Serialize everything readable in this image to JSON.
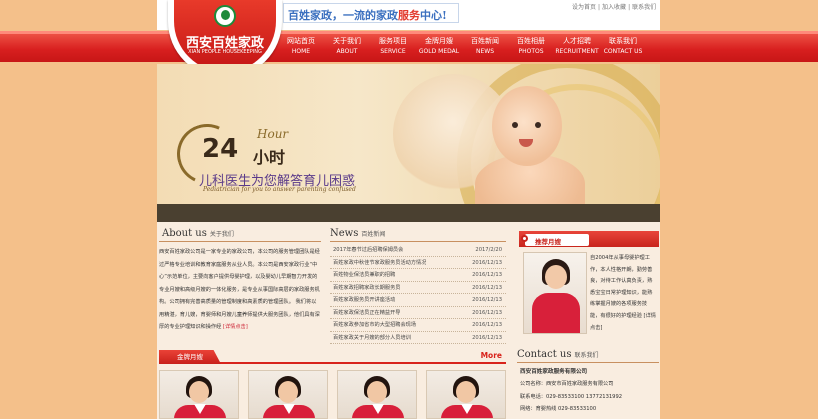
{
  "slogan": {
    "blue": "百姓家政，一流的家政",
    "red": "服务",
    "end": "中心!"
  },
  "toplinks": [
    "设为首页",
    "|",
    "加入收藏",
    "|",
    "联系我们"
  ],
  "logo": {
    "zh": "西安百姓家政",
    "en": "XIAN PEOPLE HOUSEKEEPING"
  },
  "nav": [
    {
      "zh": "网站首页",
      "en": "HOME"
    },
    {
      "zh": "关于我们",
      "en": "ABOUT"
    },
    {
      "zh": "服务项目",
      "en": "SERVICE"
    },
    {
      "zh": "金牌月嫂",
      "en": "GOLD MEDAL"
    },
    {
      "zh": "百姓新闻",
      "en": "NEWS"
    },
    {
      "zh": "百姓相册",
      "en": "PHOTOS"
    },
    {
      "zh": "人才招聘",
      "en": "RECRUITMENT"
    },
    {
      "zh": "联系我们",
      "en": "CONTACT US"
    }
  ],
  "banner": {
    "hour": "Hour",
    "big": "24",
    "hours": "小时",
    "tagline": "儿科医生为您解答育儿困惑",
    "tagline_en": "Pediatrician for you to answer parenting confused"
  },
  "about": {
    "big": "About us",
    "small": "关于我们",
    "text": "西安百姓家政公司是一家专业的家政公司，本公司的服务管理团队是经过严格专业培训和教育家庭服务从业人员。本公司是西安家政行业“中心”示范单位，主要向客户提供母婴护理，以及婴幼儿早期智力开发的专业月嫂和高级月嫂的一体化服务，是专业从事国际高层的家政服务机构。公司拥有完善高质量的管理制度和高素质的管理团队。 我们将以用精湛，育儿嫂，育婴师和月嫂儿童养师提供大服务团队，他们具有深厚的专业护理知识和操作经",
    "more": "[详情点击]"
  },
  "news": {
    "big": "News",
    "small": "百姓新闻",
    "items": [
      {
        "title": "2017年春节过后招聘保姆员会",
        "date": "2017/2/20"
      },
      {
        "title": "百姓家政中秋佳节家政服务员活动方情况",
        "date": "2016/12/13"
      },
      {
        "title": "百姓物业保洁员兼职的招聘",
        "date": "2016/12/13"
      },
      {
        "title": "百姓家政招聘家政长期服务员",
        "date": "2016/12/13"
      },
      {
        "title": "百姓家政服务员开讲座活动",
        "date": "2016/12/13"
      },
      {
        "title": "百姓家政保洁员正在精益开导",
        "date": "2016/12/13"
      },
      {
        "title": "百姓家政参加省市的大型招聘会现场",
        "date": "2016/12/13"
      },
      {
        "title": "百姓家政关于月嫂的部分人员培训",
        "date": "2016/12/13"
      }
    ]
  },
  "recommend": {
    "label": "推荐月嫂",
    "text": "自2004年从事母婴护理工作，本人性格开朗，勤劳善良，对待工作认真负责，熟悉宝宝日常护理知识，能熟练掌握月嫂的各项服务技能，有很好的护理经验",
    "more": "[详情点击]"
  },
  "goldmedal": {
    "tab": "金牌月嫂",
    "more": "More",
    "count": 4
  },
  "contact": {
    "big": "Contact us",
    "small": "联系我们",
    "company": "西安百姓家政服务有限公司",
    "lines": [
      "公司名称：西安市百姓家政服务有限公司",
      "联系电话：029-83533100  13772131992",
      "网络：育婴热线 029-83533100"
    ]
  }
}
